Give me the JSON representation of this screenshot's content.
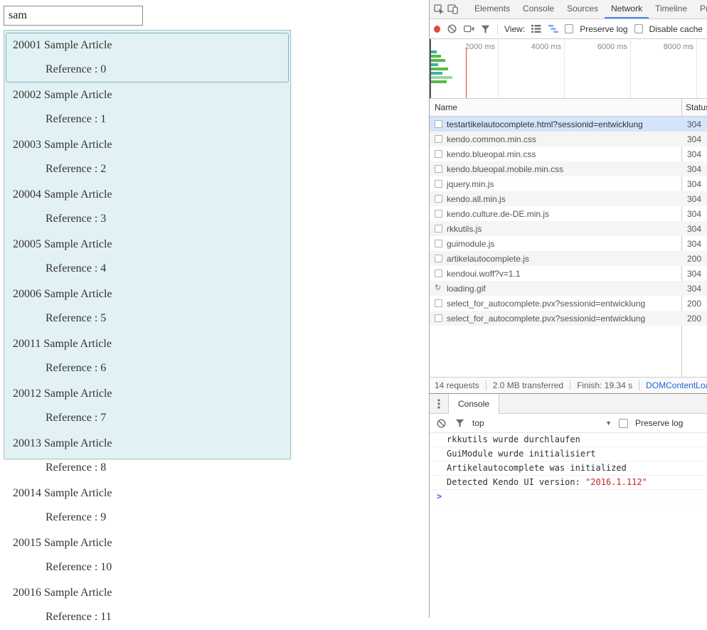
{
  "page": {
    "input": {
      "value": "sam",
      "placeholder": ""
    },
    "autocomplete": {
      "items": [
        {
          "title": "20001 Sample Article",
          "reference": "Reference : 0"
        },
        {
          "title": "20002 Sample Article",
          "reference": "Reference : 1"
        },
        {
          "title": "20003 Sample Article",
          "reference": "Reference : 2"
        },
        {
          "title": "20004 Sample Article",
          "reference": "Reference : 3"
        },
        {
          "title": "20005 Sample Article",
          "reference": "Reference : 4"
        },
        {
          "title": "20006 Sample Article",
          "reference": "Reference : 5"
        },
        {
          "title": "20011 Sample Article",
          "reference": "Reference : 6"
        },
        {
          "title": "20012 Sample Article",
          "reference": "Reference : 7"
        },
        {
          "title": "20013 Sample Article",
          "reference": "Reference : 8"
        },
        {
          "title": "20014 Sample Article",
          "reference": "Reference : 9"
        },
        {
          "title": "20015 Sample Article",
          "reference": "Reference : 10"
        },
        {
          "title": "20016 Sample Article",
          "reference": "Reference : 11"
        }
      ]
    }
  },
  "devtools": {
    "tabs": [
      {
        "label": "Elements",
        "active": false
      },
      {
        "label": "Console",
        "active": false
      },
      {
        "label": "Sources",
        "active": false
      },
      {
        "label": "Network",
        "active": true
      },
      {
        "label": "Timeline",
        "active": false
      },
      {
        "label": "Profiles",
        "active": false
      }
    ],
    "network": {
      "toolbar": {
        "view_label": "View:",
        "preserve_log_label": "Preserve log",
        "disable_cache_label": "Disable cache"
      },
      "timeline_ticks": [
        "2000 ms",
        "4000 ms",
        "6000 ms",
        "8000 ms"
      ],
      "columns": {
        "name": "Name",
        "status": "Status"
      },
      "rows": [
        {
          "name": "testartikelautocomplete.html?sessionid=entwicklung",
          "status": "304",
          "selected": true,
          "icon": "doc"
        },
        {
          "name": "kendo.common.min.css",
          "status": "304",
          "selected": false,
          "icon": "doc"
        },
        {
          "name": "kendo.blueopal.min.css",
          "status": "304",
          "selected": false,
          "icon": "doc"
        },
        {
          "name": "kendo.blueopal.mobile.min.css",
          "status": "304",
          "selected": false,
          "icon": "doc"
        },
        {
          "name": "jquery.min.js",
          "status": "304",
          "selected": false,
          "icon": "doc"
        },
        {
          "name": "kendo.all.min.js",
          "status": "304",
          "selected": false,
          "icon": "doc"
        },
        {
          "name": "kendo.culture.de-DE.min.js",
          "status": "304",
          "selected": false,
          "icon": "doc"
        },
        {
          "name": "rkkutils.js",
          "status": "304",
          "selected": false,
          "icon": "doc"
        },
        {
          "name": "guimodule.js",
          "status": "304",
          "selected": false,
          "icon": "doc"
        },
        {
          "name": "artikelautocomplete.js",
          "status": "200",
          "selected": false,
          "icon": "doc"
        },
        {
          "name": "kendoui.woff?v=1.1",
          "status": "304",
          "selected": false,
          "icon": "doc"
        },
        {
          "name": "loading.gif",
          "status": "304",
          "selected": false,
          "icon": "spinner"
        },
        {
          "name": "select_for_autocomplete.pvx?sessionid=entwicklung",
          "status": "200",
          "selected": false,
          "icon": "doc"
        },
        {
          "name": "select_for_autocomplete.pvx?sessionid=entwicklung",
          "status": "200",
          "selected": false,
          "icon": "doc"
        }
      ],
      "summary": [
        {
          "text": "14 requests",
          "link": false
        },
        {
          "text": "2.0 MB transferred",
          "link": false
        },
        {
          "text": "Finish: 19.34 s",
          "link": false
        },
        {
          "text": "DOMContentLoaded",
          "link": true
        }
      ]
    },
    "console": {
      "tab_label": "Console",
      "context_label": "top",
      "preserve_log_label": "Preserve log",
      "messages": [
        {
          "text": "rkkutils wurde durchlaufen",
          "value": ""
        },
        {
          "text": "GuiModule wurde initialisiert",
          "value": ""
        },
        {
          "text": "Artikelautocomplete was initialized",
          "value": ""
        },
        {
          "text": "Detected Kendo UI version: ",
          "value": "\"2016.1.112\""
        }
      ]
    },
    "colors": {
      "accent_blue": "#4285f4",
      "record_red": "#e04a3f",
      "selected_row_bg": "#d4e4fb",
      "link_blue": "#1a66d9",
      "string_red": "#c5221f",
      "dropdown_bg": "#e2f1f4",
      "dropdown_border": "#9fc7cd"
    }
  }
}
